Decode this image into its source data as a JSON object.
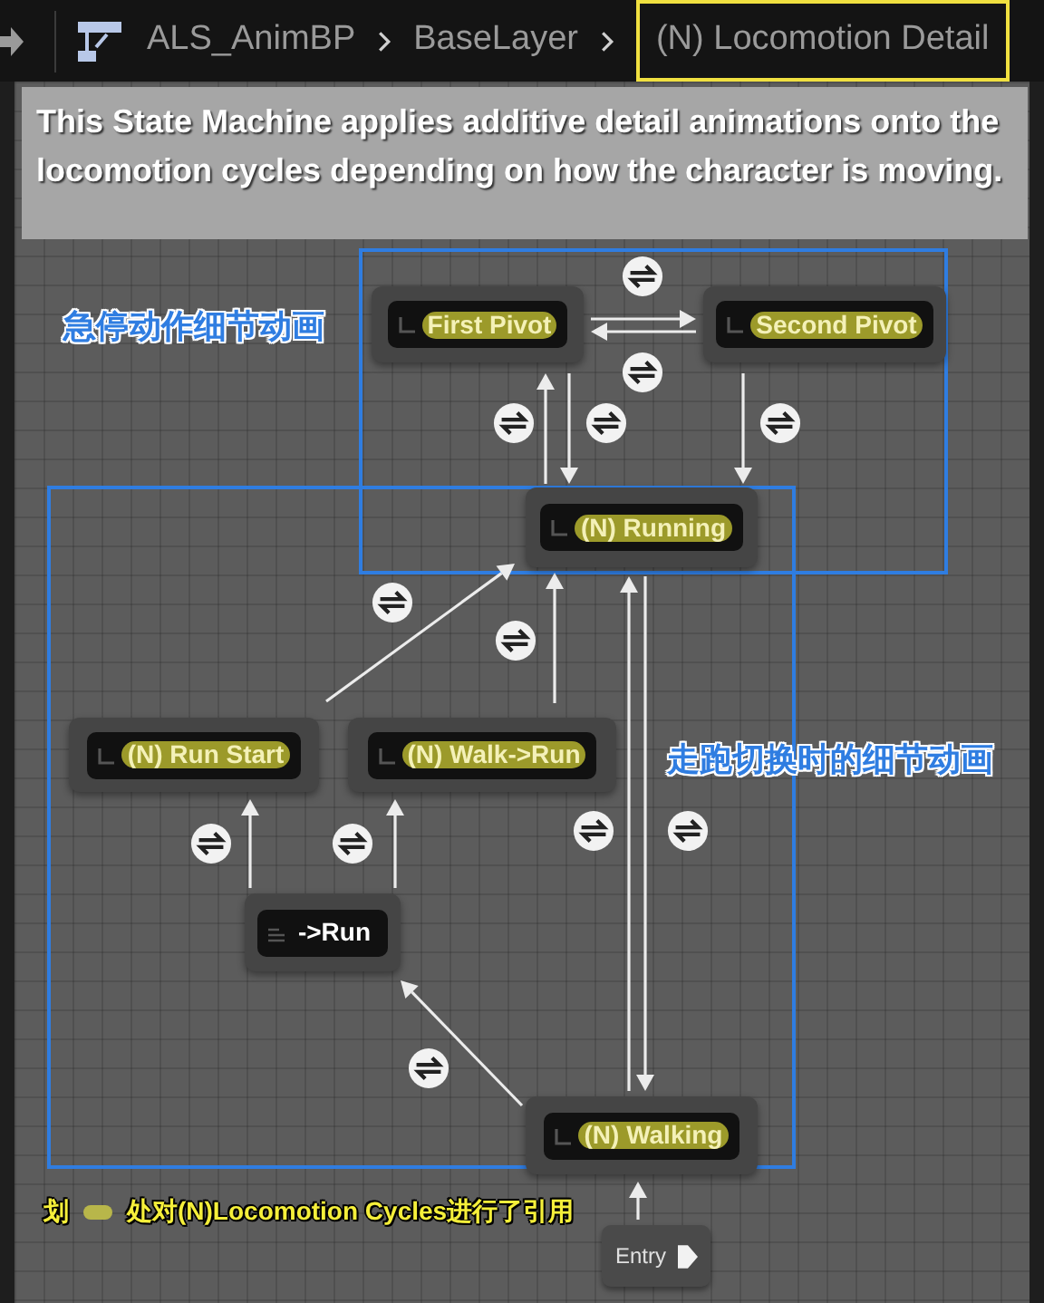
{
  "breadcrumb": [
    {
      "label": "ALS_AnimBP",
      "highlighted": false
    },
    {
      "label": "BaseLayer",
      "highlighted": false
    },
    {
      "label": "(N) Locomotion Detail",
      "highlighted": true
    }
  ],
  "comment": "This State Machine applies additive detail animations onto the locomotion cycles depending on how the character is moving.",
  "regions": [
    {
      "label": "急停动作细节动画"
    },
    {
      "label": "走跑切换时的细节动画"
    }
  ],
  "nodes": [
    {
      "kind": "state",
      "label": "First Pivot",
      "marked": true
    },
    {
      "kind": "state",
      "label": "Second Pivot",
      "marked": true
    },
    {
      "kind": "state",
      "label": "(N) Running",
      "marked": true
    },
    {
      "kind": "state",
      "label": "(N) Run Start",
      "marked": true
    },
    {
      "kind": "state",
      "label": "(N) Walk->Run",
      "marked": true
    },
    {
      "kind": "conduit",
      "label": "->Run",
      "marked": false
    },
    {
      "kind": "state",
      "label": "(N) Walking",
      "marked": true
    },
    {
      "kind": "entry",
      "label": "Entry"
    }
  ],
  "note": {
    "before": "划",
    "after": "处对(N)Locomotion Cycles进行了引用"
  }
}
